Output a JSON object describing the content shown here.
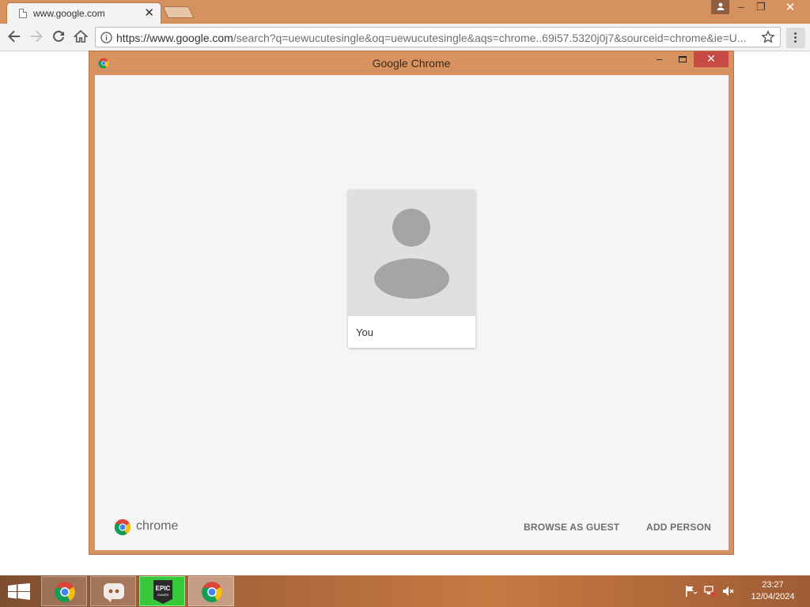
{
  "browser": {
    "tab": {
      "title": "www.google.com",
      "close_label": "✕"
    },
    "window_controls": {
      "minimize": "–",
      "restore": "❐",
      "close": "✕"
    },
    "url": {
      "host_part": "https://www.google.com",
      "rest_part": "/search?q=uewucutesingle&oq=uewucutesingle&aqs=chrome..69i57.5320j0j7&sourceid=chrome&ie=U..."
    }
  },
  "dialog": {
    "title": "Google Chrome",
    "controls": {
      "minimize": "–",
      "close": "✕"
    },
    "profiles": [
      {
        "name": "You"
      }
    ],
    "brand_word": "chrome",
    "browse_as_guest_label": "BROWSE AS GUEST",
    "add_person_label": "ADD PERSON"
  },
  "taskbar": {
    "apps": [
      "chrome",
      "discord",
      "epic-games",
      "chrome"
    ],
    "epic_label_top": "EPIC",
    "epic_label_bottom": "GAMES",
    "time": "23:27",
    "date": "12/04/2024"
  },
  "colors": {
    "window_frame": "#d6925e",
    "dialog_close": "#c74a45",
    "epic_highlight": "#37c93b"
  }
}
